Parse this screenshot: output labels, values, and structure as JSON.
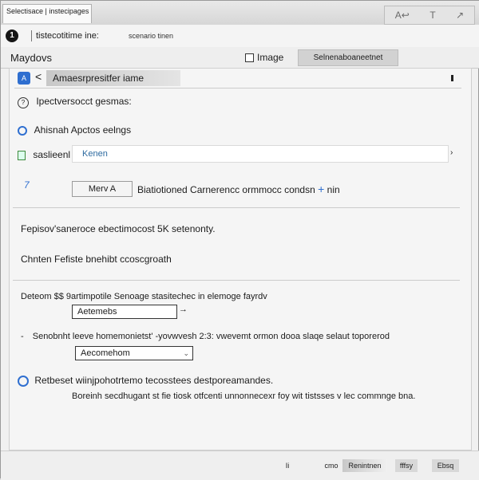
{
  "titlebar": {
    "tab_label": "Selectisace | instecipages",
    "controls": [
      "A↩",
      "T",
      "↗"
    ]
  },
  "toolbar": {
    "path": "tistecotitime ine:",
    "meta": "scenario tinen"
  },
  "menu": {
    "label": "Maydovs",
    "image_label": "Image",
    "action_button": "Selnenaboaneetnet"
  },
  "header": {
    "back": "<",
    "title": "Amaesrpresitfer iame"
  },
  "content": {
    "line1": "Ipectversocct gesmas:",
    "line2": "Ahisnah Apctos eelngs",
    "search_label": "saslieenl",
    "search_value": "Kenen",
    "menu_button": "Merv A",
    "menu_desc": "Biatiotioned Carnerencc ormmocc condsn",
    "menu_desc_tail": "nin",
    "para1": "Fepisov'saneroce ebectimocost 5K setenonty.",
    "para2": "Chnten Fefiste bnehibt ccoscgroath",
    "detail_label": "Deteom $$ 9artimpotile Senoage stasitechec in elemoge fayrdv",
    "detail_value": "Aetemebs",
    "select_desc": "Senobnht leeve homemonietst' -yovwvesh 2:3: vwevemt ormon dooa slaqe selaut toporerod",
    "select_value": "Aecomehom",
    "info_title": "Retbeset wiinjpohotrtemo tecosstees destporeamandes.",
    "info_body": "Boreinh secdhugant st fie tiosk otfcenti unnonnecexr foy wit tistsses  v lec commnge bna."
  },
  "bottom": {
    "b1": "Ii",
    "b2": "cmo",
    "b3": "Renintnen",
    "b4": "fffsy",
    "b5": "Ebsq"
  }
}
